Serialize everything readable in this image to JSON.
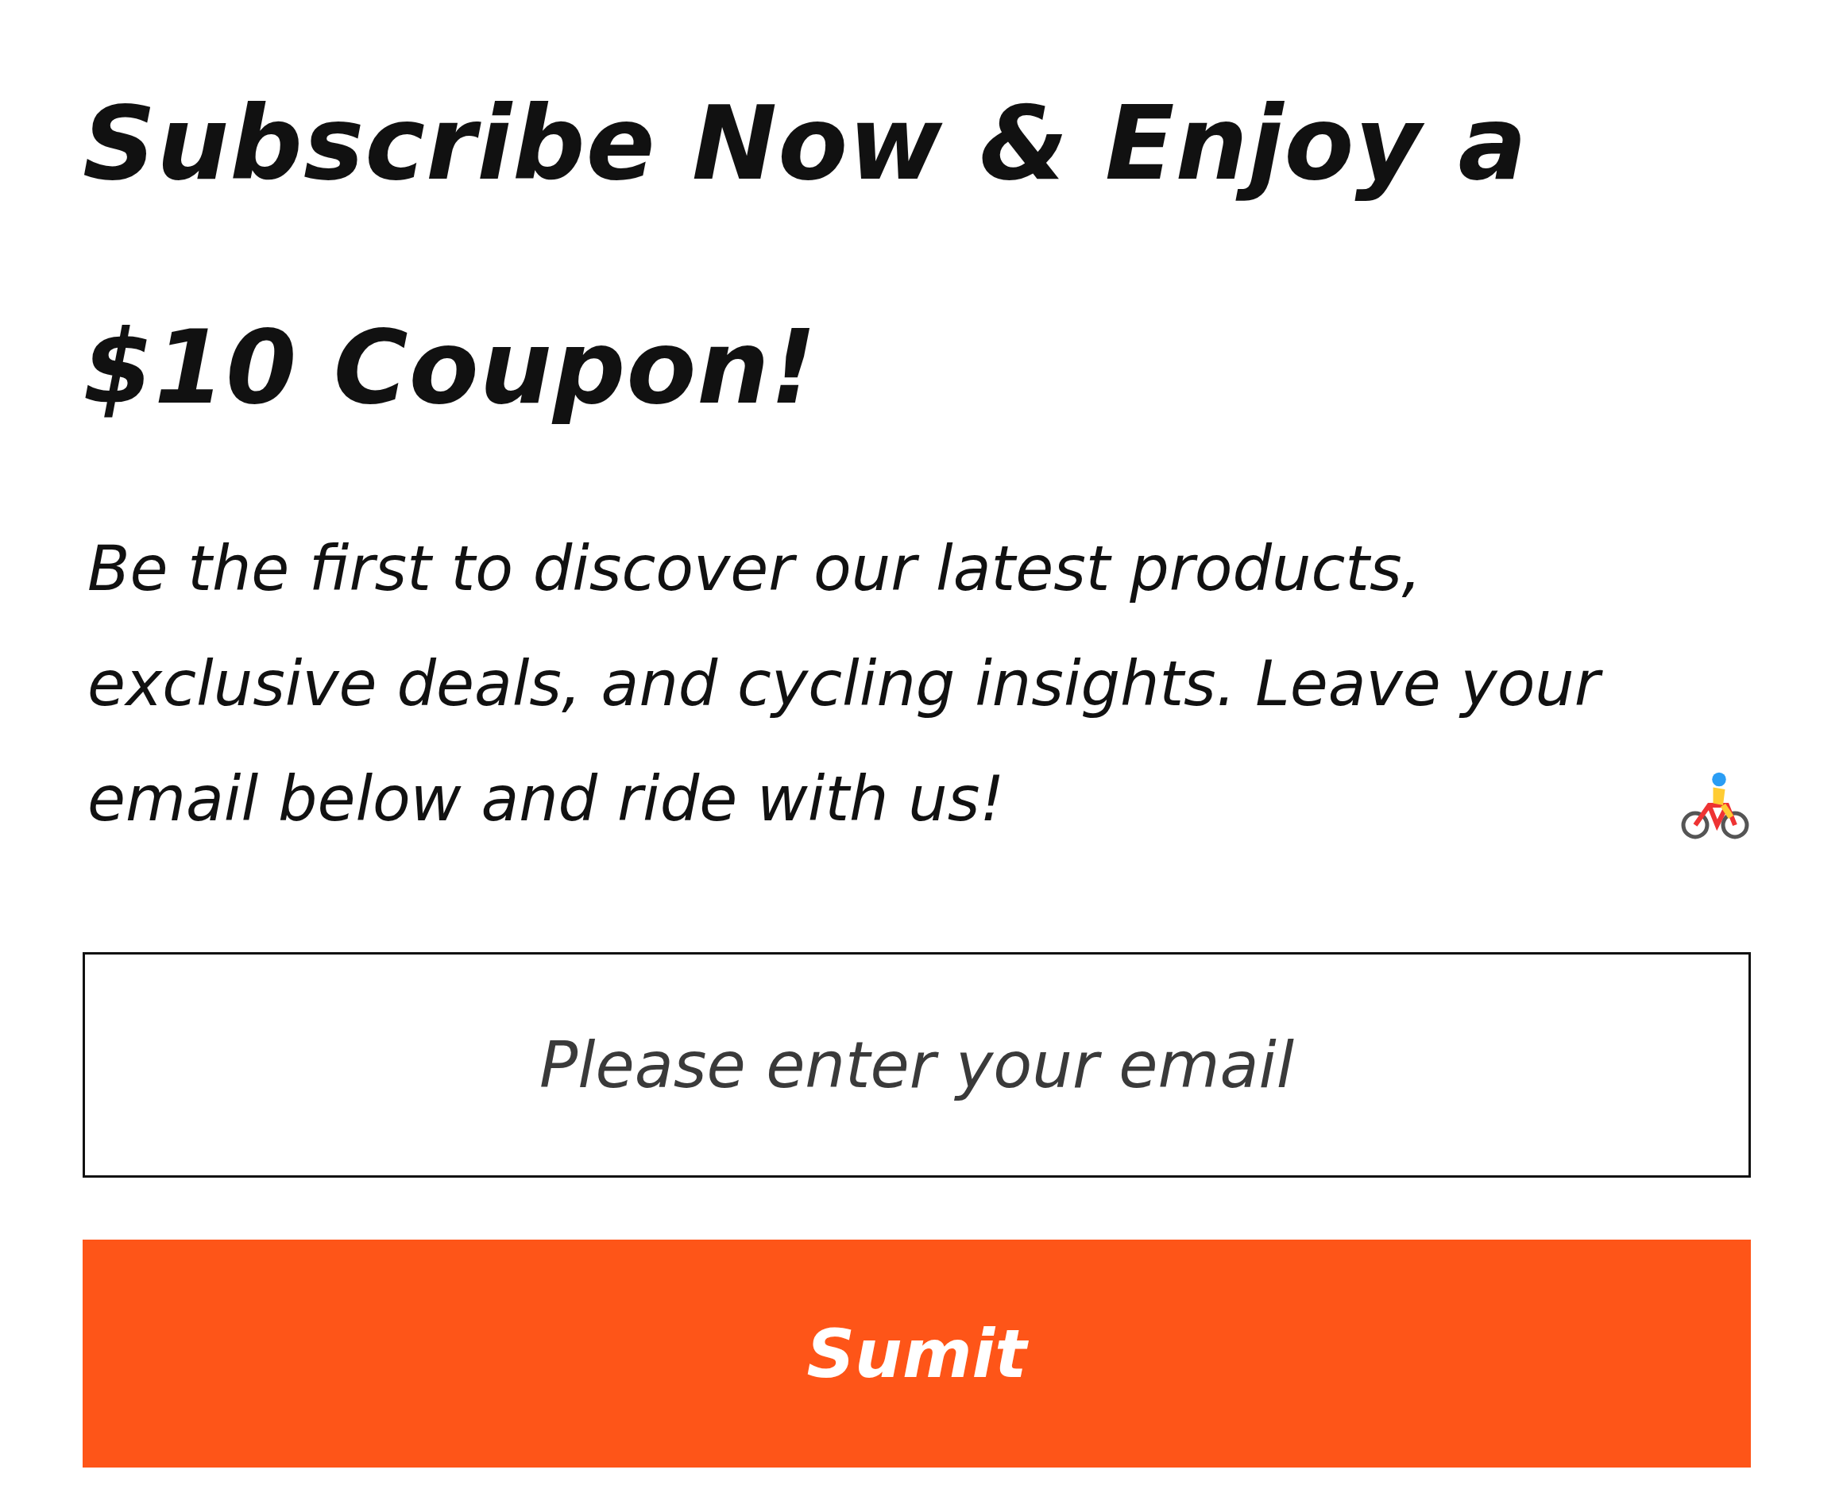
{
  "heading": "Subscribe Now & Enjoy a $10 Coupon!",
  "intro": "Be the first to discover our latest products, exclusive deals, and cycling insights. Leave your email below and ride with us!",
  "email_field": {
    "placeholder": "Please enter your email"
  },
  "submit_button": "Sumit"
}
